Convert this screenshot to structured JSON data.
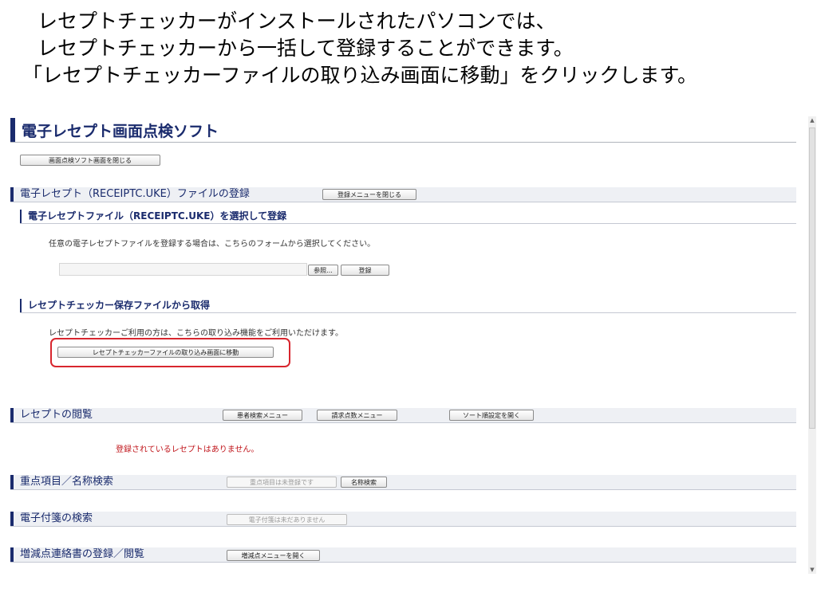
{
  "caption": {
    "line1": "レセプトチェッカーがインストールされたパソコンでは、",
    "line2": "レセプトチェッカーから一括して登録することができます。",
    "line3": "「レセプトチェッカーファイルの取り込み画面に移動」をクリックします。"
  },
  "app": {
    "title": "電子レセプト画面点検ソフト",
    "close_button": "画面点検ソフト画面を閉じる"
  },
  "register": {
    "title": "電子レセプト（RECEIPTC.UKE）ファイルの登録",
    "close_menu_button": "登録メニューを閉じる",
    "file_section": {
      "title": "電子レセプトファイル（RECEIPTC.UKE）を選択して登録",
      "description": "任意の電子レセプトファイルを登録する場合は、こちらのフォームから選択してください。",
      "file_value": "",
      "browse_button": "参照...",
      "register_button": "登録"
    },
    "checker_section": {
      "title": "レセプトチェッカー保存ファイルから取得",
      "description": "レセプトチェッカーご利用の方は、こちらの取り込み機能をご利用いただけます。",
      "move_button": "レセプトチェッカーファイルの取り込み画面に移動"
    }
  },
  "browse": {
    "title": "レセプトの閲覧",
    "patient_search_button": "患者検索メニュー",
    "claim_points_button": "請求点数メニュー",
    "sort_button": "ソート順設定を開く",
    "empty_message": "登録されているレセプトはありません。"
  },
  "priority": {
    "title": "重点項目／名称検索",
    "unregistered_button": "重点項目は未登録です",
    "name_search_button": "名称検索"
  },
  "sticky": {
    "title": "電子付箋の検索",
    "none_button": "電子付箋は未だありません"
  },
  "adjust": {
    "title": "増減点連絡書の登録／閲覧",
    "menu_button": "増減点メニューを開く"
  },
  "colors": {
    "navy": "#1a2b6d",
    "highlight": "#d8262e",
    "notice": "#c0141a"
  }
}
